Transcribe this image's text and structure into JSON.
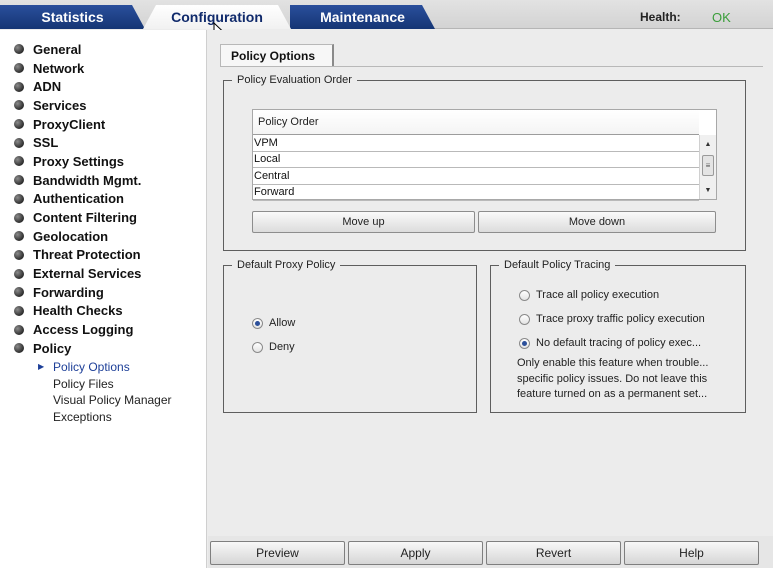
{
  "tabs": [
    {
      "label": "Statistics"
    },
    {
      "label": "Configuration"
    },
    {
      "label": "Maintenance"
    }
  ],
  "health": {
    "label": "Health:",
    "value": "OK",
    "value_color": "#3a9e3a"
  },
  "sidebar": {
    "items": [
      {
        "label": "General"
      },
      {
        "label": "Network"
      },
      {
        "label": "ADN"
      },
      {
        "label": "Services"
      },
      {
        "label": "ProxyClient"
      },
      {
        "label": "SSL"
      },
      {
        "label": "Proxy Settings"
      },
      {
        "label": "Bandwidth Mgmt."
      },
      {
        "label": "Authentication"
      },
      {
        "label": "Content Filtering"
      },
      {
        "label": "Geolocation"
      },
      {
        "label": "Threat Protection"
      },
      {
        "label": "External Services"
      },
      {
        "label": "Forwarding"
      },
      {
        "label": "Health Checks"
      },
      {
        "label": "Access Logging"
      },
      {
        "label": "Policy"
      }
    ],
    "policy_subitems": [
      {
        "label": "Policy Options",
        "active": true
      },
      {
        "label": "Policy Files"
      },
      {
        "label": "Visual Policy Manager"
      },
      {
        "label": "Exceptions"
      }
    ]
  },
  "main": {
    "tab_label": "Policy Options",
    "evaluation": {
      "legend": "Policy Evaluation Order",
      "column_header": "Policy Order",
      "rows": [
        "VPM",
        "Local",
        "Central",
        "Forward"
      ],
      "move_up_label": "Move up",
      "move_down_label": "Move down"
    },
    "default_proxy": {
      "legend": "Default Proxy Policy",
      "options": [
        "Allow",
        "Deny"
      ],
      "selected": "Allow"
    },
    "tracing": {
      "legend": "Default Policy Tracing",
      "options": [
        "Trace all policy execution",
        "Trace proxy traffic policy execution",
        "No default tracing of policy exec..."
      ],
      "selected": "No default tracing of policy exec...",
      "note_lines": [
        "Only enable this feature when trouble...",
        "specific policy issues.  Do not leave this",
        "feature turned on as a permanent set..."
      ]
    }
  },
  "footer": {
    "preview_label": "Preview",
    "apply_label": "Apply",
    "revert_label": "Revert",
    "help_label": "Help"
  },
  "colors": {
    "tab_dark": "#153574",
    "accent_link": "#1d3f98"
  }
}
